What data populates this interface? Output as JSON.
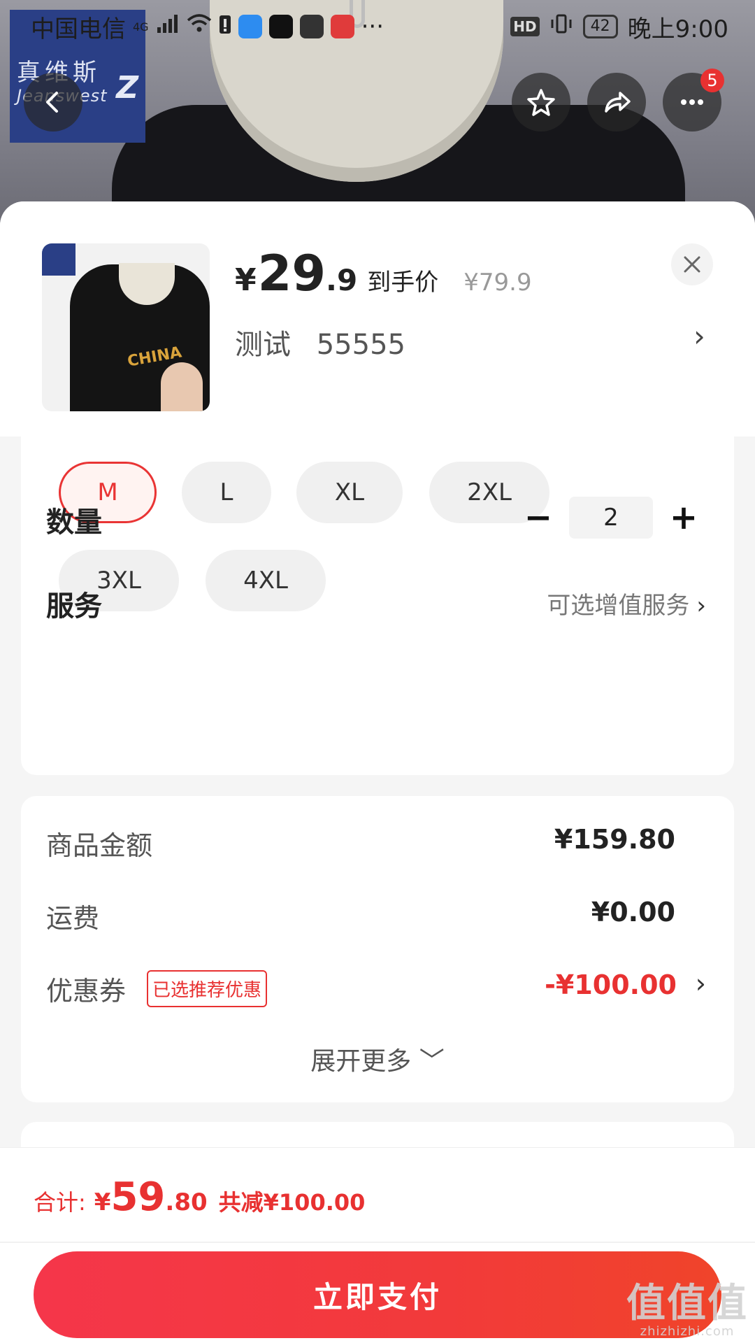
{
  "status_bar": {
    "carrier": "中国电信",
    "network": "4G",
    "hd": "HD",
    "battery": "42",
    "time": "晚上9:00",
    "more": "···"
  },
  "header": {
    "brand_cn": "真维斯",
    "brand_en": "Jeanswest",
    "more_badge": "5"
  },
  "product": {
    "currency": "¥",
    "price_int": "29",
    "price_dec": ".9",
    "price_tag": "到手价",
    "original_price": "¥79.9",
    "variant_name": "测试",
    "variant_code": "55555",
    "thumb_print": "CHINA"
  },
  "sizes": [
    "M",
    "L",
    "XL",
    "2XL",
    "3XL",
    "4XL"
  ],
  "selected_size": "M",
  "quantity": {
    "label": "数量",
    "value": "2",
    "minus": "−",
    "plus": "+"
  },
  "service": {
    "label": "服务",
    "value": "可选增值服务",
    "chevron": "›"
  },
  "amounts": {
    "goods_label": "商品金额",
    "goods_value": "¥159.80",
    "shipping_label": "运费",
    "shipping_value": "¥0.00",
    "coupon_label": "优惠券",
    "coupon_tag": "已选推荐优惠",
    "coupon_value": "-¥100.00",
    "expand": "展开更多 ﹀"
  },
  "bottom": {
    "total_label": "合计:",
    "currency": "¥",
    "total_int": "59",
    "total_dec": ".80",
    "reduce": "共减¥100.00",
    "pay_label": "立即支付"
  },
  "watermark": {
    "big": "值值值",
    "small": "zhizhizhi.com"
  },
  "colors": {
    "accent_red": "#e83131",
    "pay_button": "#f23a3a"
  }
}
